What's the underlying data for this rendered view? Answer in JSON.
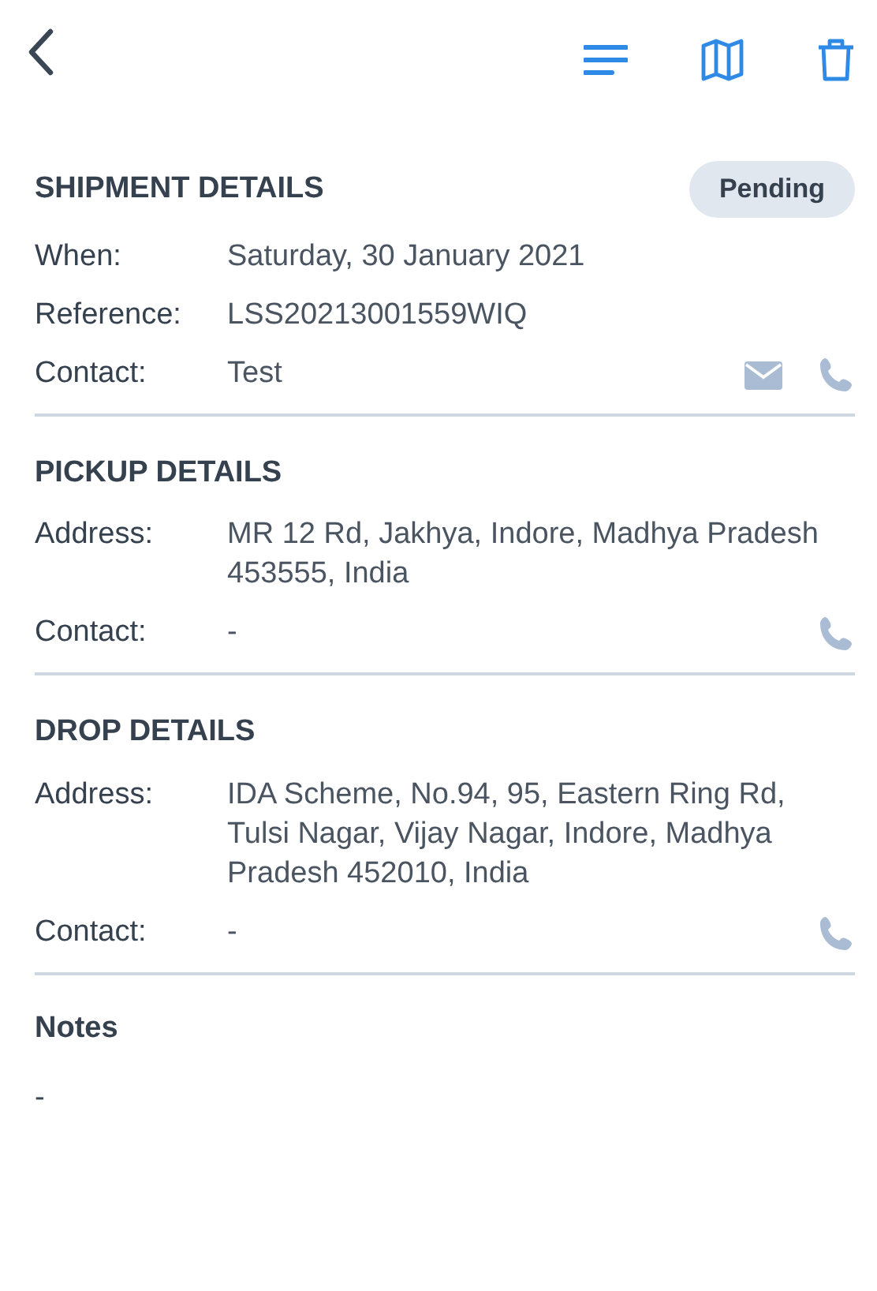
{
  "toolbar": {
    "actions": [
      {
        "kind": "menu"
      },
      {
        "kind": "map"
      },
      {
        "kind": "trash"
      }
    ]
  },
  "sections": [
    {
      "title": "SHIPMENT DETAILS",
      "status": "Pending",
      "fields": [
        {
          "label": "When:",
          "value": "Saturday, 30 January 2021"
        },
        {
          "label": "Reference:",
          "value": "LSS20213001559WIQ"
        },
        {
          "label": "Contact:",
          "value": "Test",
          "actions": [
            {
              "kind": "email"
            },
            {
              "kind": "phone"
            }
          ]
        }
      ]
    },
    {
      "title": "PICKUP DETAILS",
      "fields": [
        {
          "label": "Address:",
          "value": "MR 12 Rd, Jakhya, Indore, Madhya Pradesh 453555, India"
        },
        {
          "label": "Contact:",
          "value": "-",
          "actions": [
            {
              "kind": "phone"
            }
          ]
        }
      ]
    },
    {
      "title": "DROP DETAILS",
      "fields": [
        {
          "label": "Address:",
          "value": "IDA Scheme, No.94, 95, Eastern Ring Rd, Tulsi Nagar, Vijay Nagar, Indore, Madhya Pradesh 452010, India"
        },
        {
          "label": "Contact:",
          "value": "-",
          "actions": [
            {
              "kind": "phone"
            }
          ]
        }
      ]
    }
  ],
  "notes": {
    "title": "Notes",
    "text": "-"
  }
}
